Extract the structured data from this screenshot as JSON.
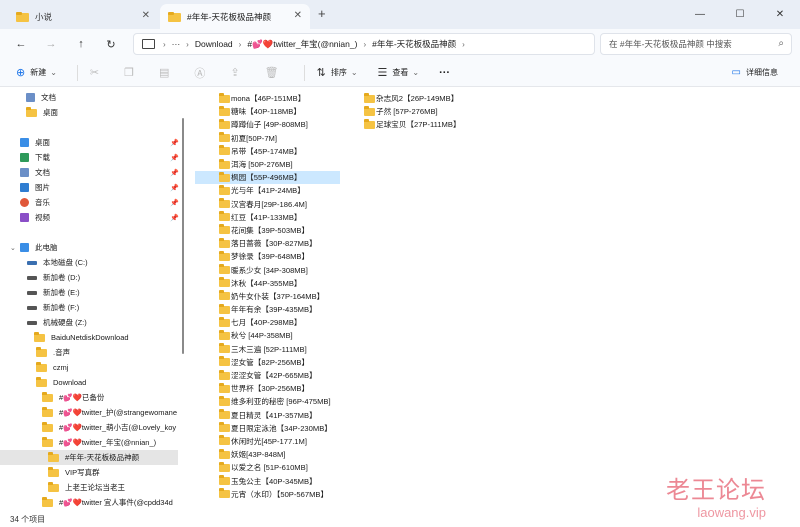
{
  "tabs": [
    {
      "label": "小说"
    },
    {
      "label": "#年年-天花板极品神颜"
    }
  ],
  "nav": {
    "breadcrumbs": [
      "Download",
      "#💕❤️twitter_年宝(@nnian_)",
      "#年年-天花板极品神颜"
    ],
    "search_placeholder": "在 #年年-天花板极品神颜 中搜索"
  },
  "toolbar": {
    "new": "新建",
    "sort": "排序",
    "view": "查看",
    "more": "···",
    "details": "详细信息"
  },
  "sidebar": [
    {
      "label": "文档",
      "kind": "doc"
    },
    {
      "label": "桌面",
      "kind": "folder"
    },
    {
      "label": "桌面",
      "kind": "desk",
      "pinned": true
    },
    {
      "label": "下载",
      "kind": "down",
      "pinned": true
    },
    {
      "label": "文档",
      "kind": "doc",
      "pinned": true
    },
    {
      "label": "图片",
      "kind": "pic",
      "pinned": true
    },
    {
      "label": "音乐",
      "kind": "music",
      "pinned": true
    },
    {
      "label": "视频",
      "kind": "video",
      "pinned": true
    },
    {
      "label": "此电脑",
      "kind": "pc"
    },
    {
      "label": "本地磁盘 (C:)",
      "kind": "drive"
    },
    {
      "label": "新加卷 (D:)",
      "kind": "drive"
    },
    {
      "label": "新加卷 (E:)",
      "kind": "drive"
    },
    {
      "label": "新加卷 (F:)",
      "kind": "drive"
    },
    {
      "label": "机械硬盘 (Z:)",
      "kind": "drive"
    },
    {
      "label": "BaiduNetdiskDownload",
      "kind": "folder"
    },
    {
      "label": ".音声",
      "kind": "folder"
    },
    {
      "label": "czmj",
      "kind": "folder"
    },
    {
      "label": "Download",
      "kind": "folder"
    },
    {
      "label": "#💕❤️已备份",
      "kind": "folder"
    },
    {
      "label": "#💕❤️twitter_护(@strangewomane",
      "kind": "folder"
    },
    {
      "label": "#💕❤️twitter_萌小吉(@Lovely_koy",
      "kind": "folder"
    },
    {
      "label": "#💕❤️twitter_年宝(@nnian_)",
      "kind": "folder"
    },
    {
      "label": "#年年-天花板极品神颜",
      "kind": "folder",
      "selected": true
    },
    {
      "label": "VIP写真群",
      "kind": "folder"
    },
    {
      "label": "上老王论坛当老王",
      "kind": "folder"
    },
    {
      "label": "#💕❤️twitter 宜人事件(@cpdd34d",
      "kind": "folder"
    }
  ],
  "files_col1": [
    "mona【46P-151MB】",
    "糖味【40P-118MB】",
    "蹲蹲仙子 [49P-808MB]",
    "初夏[50P-7M]",
    "吊带【45P-174MB】",
    "洱海 [50P-276MB]",
    "枫园【55P-496MB】",
    "光与年【41P-24MB】",
    "汉宫春月[29P-186.4M]",
    "红豆【41P-133MB】",
    "花间集【39P-503MB】",
    "落日蔷薇【30P-827MB】",
    "梦徐录【39P-648MB】",
    "暖系少女 [34P-308MB]",
    "沐秋【44P-355MB】",
    "奶牛女仆装【37P-164MB】",
    "年年有余【39P-435MB】",
    "七月【40P-298MB】",
    "秋兮 [44P-358MB]",
    "三木三遍 [52P-111MB]",
    "涩女管【82P-256MB】",
    "涩涩女管【42P-665MB】",
    "世界杯【30P-256MB】",
    "维多利亚的秘密 [96P-475MB]",
    "夏日精灵【41P-357MB】",
    "夏日限定泳池【34P-230MB】",
    "休闲时光[45P-177.1M]",
    "妖姬[43P-848M]",
    "以爱之名 [51P-610MB]",
    "玉兔公主【40P-345MB】",
    "元宵（水印）【50P-567MB】"
  ],
  "files_col2": [
    "杂志风2【26P-149MB】",
    "子然 [57P-276MB]",
    "足球宝贝【27P-111MB】"
  ],
  "selected_file": "枫园【55P-496MB】",
  "status": {
    "count": "34 个项目"
  },
  "watermark": {
    "line1": "老王论坛",
    "line2": "laowang.vip"
  },
  "colors": {
    "folder": "#f5c343",
    "selection": "#cce8ff",
    "accent": "#1a73e8",
    "watermark": "#e86b7a"
  }
}
